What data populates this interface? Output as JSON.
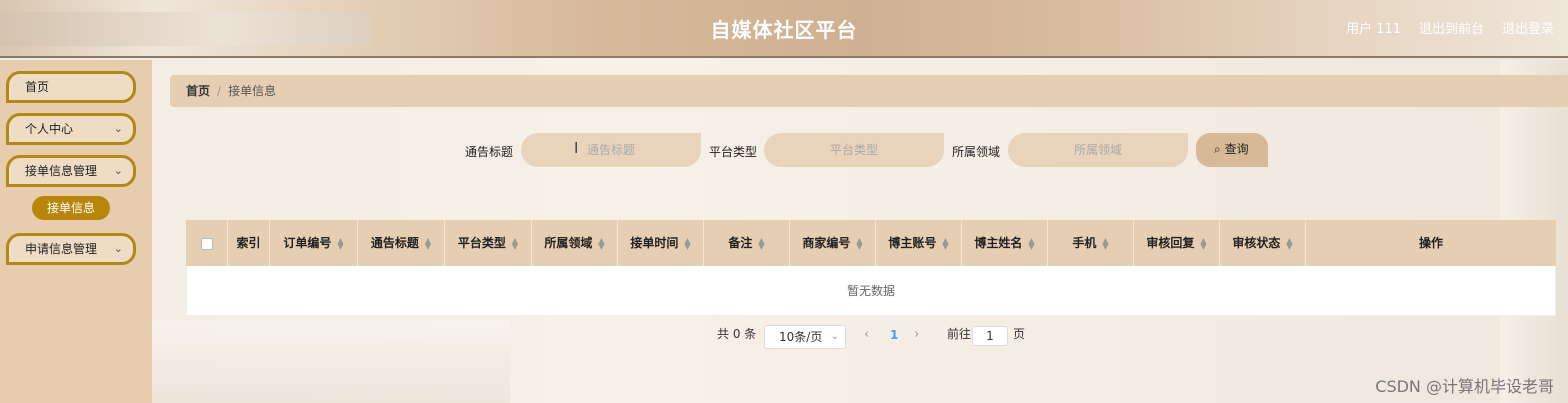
{
  "header": {
    "title": "自媒体社区平台",
    "user": "用户 111",
    "back_to_front": "退出到前台",
    "logout": "退出登录"
  },
  "sidebar": {
    "items": [
      {
        "label": "首页"
      },
      {
        "label": "个人中心"
      },
      {
        "label": "接单信息管理"
      },
      {
        "label": "申请信息管理"
      }
    ],
    "active_sub": "接单信息"
  },
  "breadcrumb": {
    "home": "首页",
    "separator": "/",
    "current": "接单信息"
  },
  "search": {
    "fields": [
      {
        "label": "通告标题",
        "placeholder": "通告标题",
        "value": ""
      },
      {
        "label": "平台类型",
        "placeholder": "平台类型",
        "value": ""
      },
      {
        "label": "所属领域",
        "placeholder": "所属领域",
        "value": ""
      }
    ],
    "button": "查询"
  },
  "table": {
    "columns": [
      "索引",
      "订单编号",
      "通告标题",
      "平台类型",
      "所属领域",
      "接单时间",
      "备注",
      "商家编号",
      "博主账号",
      "博主姓名",
      "手机",
      "审核回复",
      "审核状态",
      "操作"
    ],
    "rows": [],
    "empty_text": "暂无数据"
  },
  "pagination": {
    "total": "共 0 条",
    "page_size": "10条/页",
    "current_page": "1",
    "goto_label": "前往",
    "goto_value": "1",
    "page_unit": "页"
  },
  "watermark": "CSDN @计算机毕设老哥"
}
